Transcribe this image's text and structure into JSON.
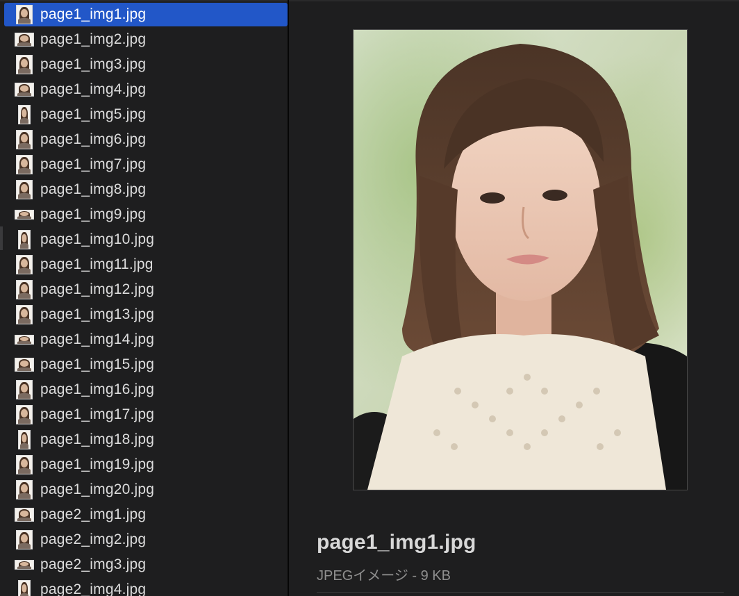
{
  "file_list": {
    "selected_index": 0,
    "items": [
      {
        "name": "page1_img1.jpg",
        "thumb": "portrait-icon"
      },
      {
        "name": "page1_img2.jpg",
        "thumb": "landscape-icon"
      },
      {
        "name": "page1_img3.jpg",
        "thumb": "portrait-icon"
      },
      {
        "name": "page1_img4.jpg",
        "thumb": "landscape-icon"
      },
      {
        "name": "page1_img5.jpg",
        "thumb": "tall-icon"
      },
      {
        "name": "page1_img6.jpg",
        "thumb": "portrait-icon"
      },
      {
        "name": "page1_img7.jpg",
        "thumb": "portrait-icon"
      },
      {
        "name": "page1_img8.jpg",
        "thumb": "portrait-icon"
      },
      {
        "name": "page1_img9.jpg",
        "thumb": "wide-icon"
      },
      {
        "name": "page1_img10.jpg",
        "thumb": "tall-icon"
      },
      {
        "name": "page1_img11.jpg",
        "thumb": "portrait-icon"
      },
      {
        "name": "page1_img12.jpg",
        "thumb": "portrait-icon"
      },
      {
        "name": "page1_img13.jpg",
        "thumb": "portrait-icon"
      },
      {
        "name": "page1_img14.jpg",
        "thumb": "wide-icon"
      },
      {
        "name": "page1_img15.jpg",
        "thumb": "landscape-icon"
      },
      {
        "name": "page1_img16.jpg",
        "thumb": "portrait-icon"
      },
      {
        "name": "page1_img17.jpg",
        "thumb": "portrait-icon"
      },
      {
        "name": "page1_img18.jpg",
        "thumb": "tall-icon"
      },
      {
        "name": "page1_img19.jpg",
        "thumb": "portrait-icon"
      },
      {
        "name": "page1_img20.jpg",
        "thumb": "portrait-icon"
      },
      {
        "name": "page2_img1.jpg",
        "thumb": "landscape-icon"
      },
      {
        "name": "page2_img2.jpg",
        "thumb": "portrait-icon"
      },
      {
        "name": "page2_img3.jpg",
        "thumb": "wide-icon"
      },
      {
        "name": "page2_img4.jpg",
        "thumb": "tall-icon"
      }
    ]
  },
  "preview": {
    "image_icon": "photo-preview-icon",
    "file_name": "page1_img1.jpg",
    "kind_and_size": "JPEGイメージ - 9 KB"
  },
  "colors": {
    "selection": "#2257c8",
    "background": "#1e1e1f",
    "text": "#dcdcdc",
    "secondary_text": "#8f8f8f"
  }
}
